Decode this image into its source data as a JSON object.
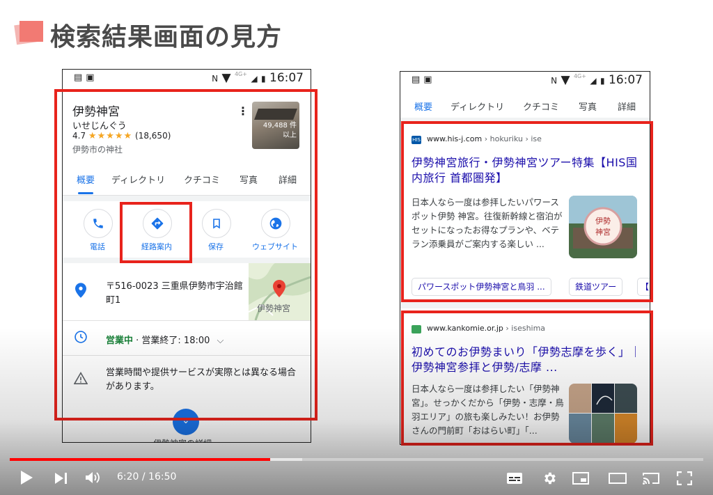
{
  "slide": {
    "title": "検索結果画面の見方"
  },
  "status_bar": {
    "time": "16:07",
    "network": "4G+"
  },
  "maps_card": {
    "name": "伊勢神宮",
    "reading": "いせじんぐう",
    "rating": "4.7",
    "stars": "★★★★★",
    "reviews": "(18,650)",
    "category": "伊勢市の神社",
    "photo_count_line1": "49,488 件",
    "photo_count_line2": "以上",
    "tabs": [
      "概要",
      "ディレクトリ",
      "クチコミ",
      "写真",
      "詳細"
    ],
    "actions": {
      "call": "電話",
      "directions": "経路案内",
      "save": "保存",
      "website": "ウェブサイト"
    },
    "address_line1": "〒516-0023 三重県伊勢市宇治館",
    "address_line2": "町1",
    "map_label": "伊勢神宮",
    "hours_open": "営業中",
    "hours_close": "· 営業終了: 18:00",
    "notice": "営業時間や提供サービスが実際とは異なる場合があります。",
    "more_label": "伊勢神宮の詳細"
  },
  "search_results": {
    "tabs": [
      "概要",
      "ディレクトリ",
      "クチコミ",
      "写真",
      "詳細"
    ],
    "result1": {
      "favicon": "HIS",
      "domain": "www.his-j.com",
      "path": " › hokuriku › ise",
      "title": "伊勢神宮旅行・伊勢神宮ツアー特集【HIS国内旅行 首都圏発】",
      "snippet": "日本人なら一度は参拝したいパワースポット伊勢 神宮。往復新幹線と宿泊がセットになったお得なプランや、ベテラン添乗員がご案内する楽しい ...",
      "chips": [
        "パワースポット伊勢神宮と鳥羽 ...",
        "鉄道ツアー",
        "【"
      ]
    },
    "result2": {
      "domain": "www.kankomie.or.jp",
      "path": " › iseshima",
      "title": "初めてのお伊勢まいり「伊勢志摩を歩く」｜伊勢神宮参拝と伊勢/志摩 ...",
      "snippet": "日本人なら一度は参拝したい「伊勢神宮」。せっかくだから「伊勢・志摩・鳥羽エリア」の旅も楽しみたい！お伊勢さんの門前町「おはらい町」「..."
    }
  },
  "player": {
    "time": "6:20 / 16:50",
    "progress_fraction": 0.376
  },
  "colors": {
    "accent_red": "#e8231c",
    "link_blue": "#1a0dab",
    "maps_blue": "#1a73e8"
  }
}
